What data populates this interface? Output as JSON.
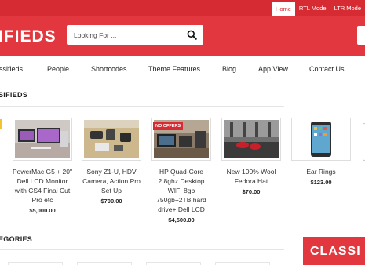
{
  "topbar": {
    "links": [
      {
        "label": "Home",
        "active": true
      },
      {
        "label": "RTL Mode",
        "active": false
      },
      {
        "label": "LTR Mode",
        "active": false
      }
    ]
  },
  "header": {
    "logo_text": "IFIEDS",
    "search_placeholder": "Looking For ...",
    "search_icon": "search-icon"
  },
  "nav": {
    "items": [
      "assifieds",
      "People",
      "Shortcodes",
      "Theme Features",
      "Blog",
      "App View",
      "Contact Us"
    ]
  },
  "sections": {
    "classifieds_title": "SIFIEDS",
    "categories_title": "EGORIES"
  },
  "listings": [
    {
      "title": "PowerMac G5 + 20\" Dell LCD Monitor with CS4 Final Cut Pro etc",
      "price": "$5,000.00",
      "badge": ""
    },
    {
      "title": "Sony Z1-U, HDV Camera, Action Pro Set Up",
      "price": "$700.00",
      "badge": ""
    },
    {
      "title": "HP Quad-Core 2.8ghz Desktop WIFI 8gb 750gb+2TB hard drive+ Dell LCD",
      "price": "$4,500.00",
      "badge": "NO OFFERS"
    },
    {
      "title": "New 100% Wool Fedora Hat",
      "price": "$70.00",
      "badge": ""
    },
    {
      "title": "Ear Rings",
      "price": "$123.00",
      "badge": ""
    }
  ],
  "banner": {
    "text": "CLASSI"
  },
  "colors": {
    "brand_red": "#e2373e",
    "topbar_red": "#d62b32",
    "accent_yellow": "#f2c233"
  }
}
